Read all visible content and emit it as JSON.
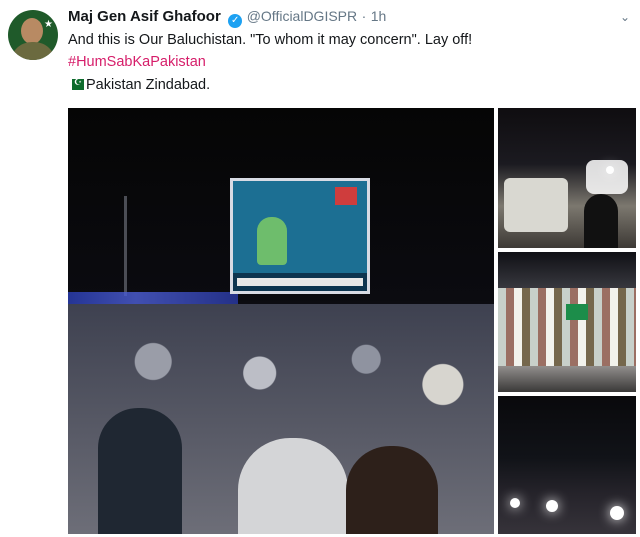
{
  "tweet": {
    "display_name": "Maj Gen Asif Ghafoor",
    "handle": "@OfficialDGISPR",
    "separator": "·",
    "time": "1h",
    "text_line1": "And this is Our Baluchistan. \"To whom it may concern\". Lay off!",
    "hashtag": "#HumSabKaPakistan",
    "text_line3": "Pakistan Zindabad.",
    "icons": [
      "avatar",
      "verified-badge-icon",
      "chevron-down-icon",
      "pakistan-flag-emoji"
    ],
    "colors": {
      "hashtag": "#d61e6a",
      "verified": "#1da1f2",
      "muted": "#657786"
    }
  }
}
